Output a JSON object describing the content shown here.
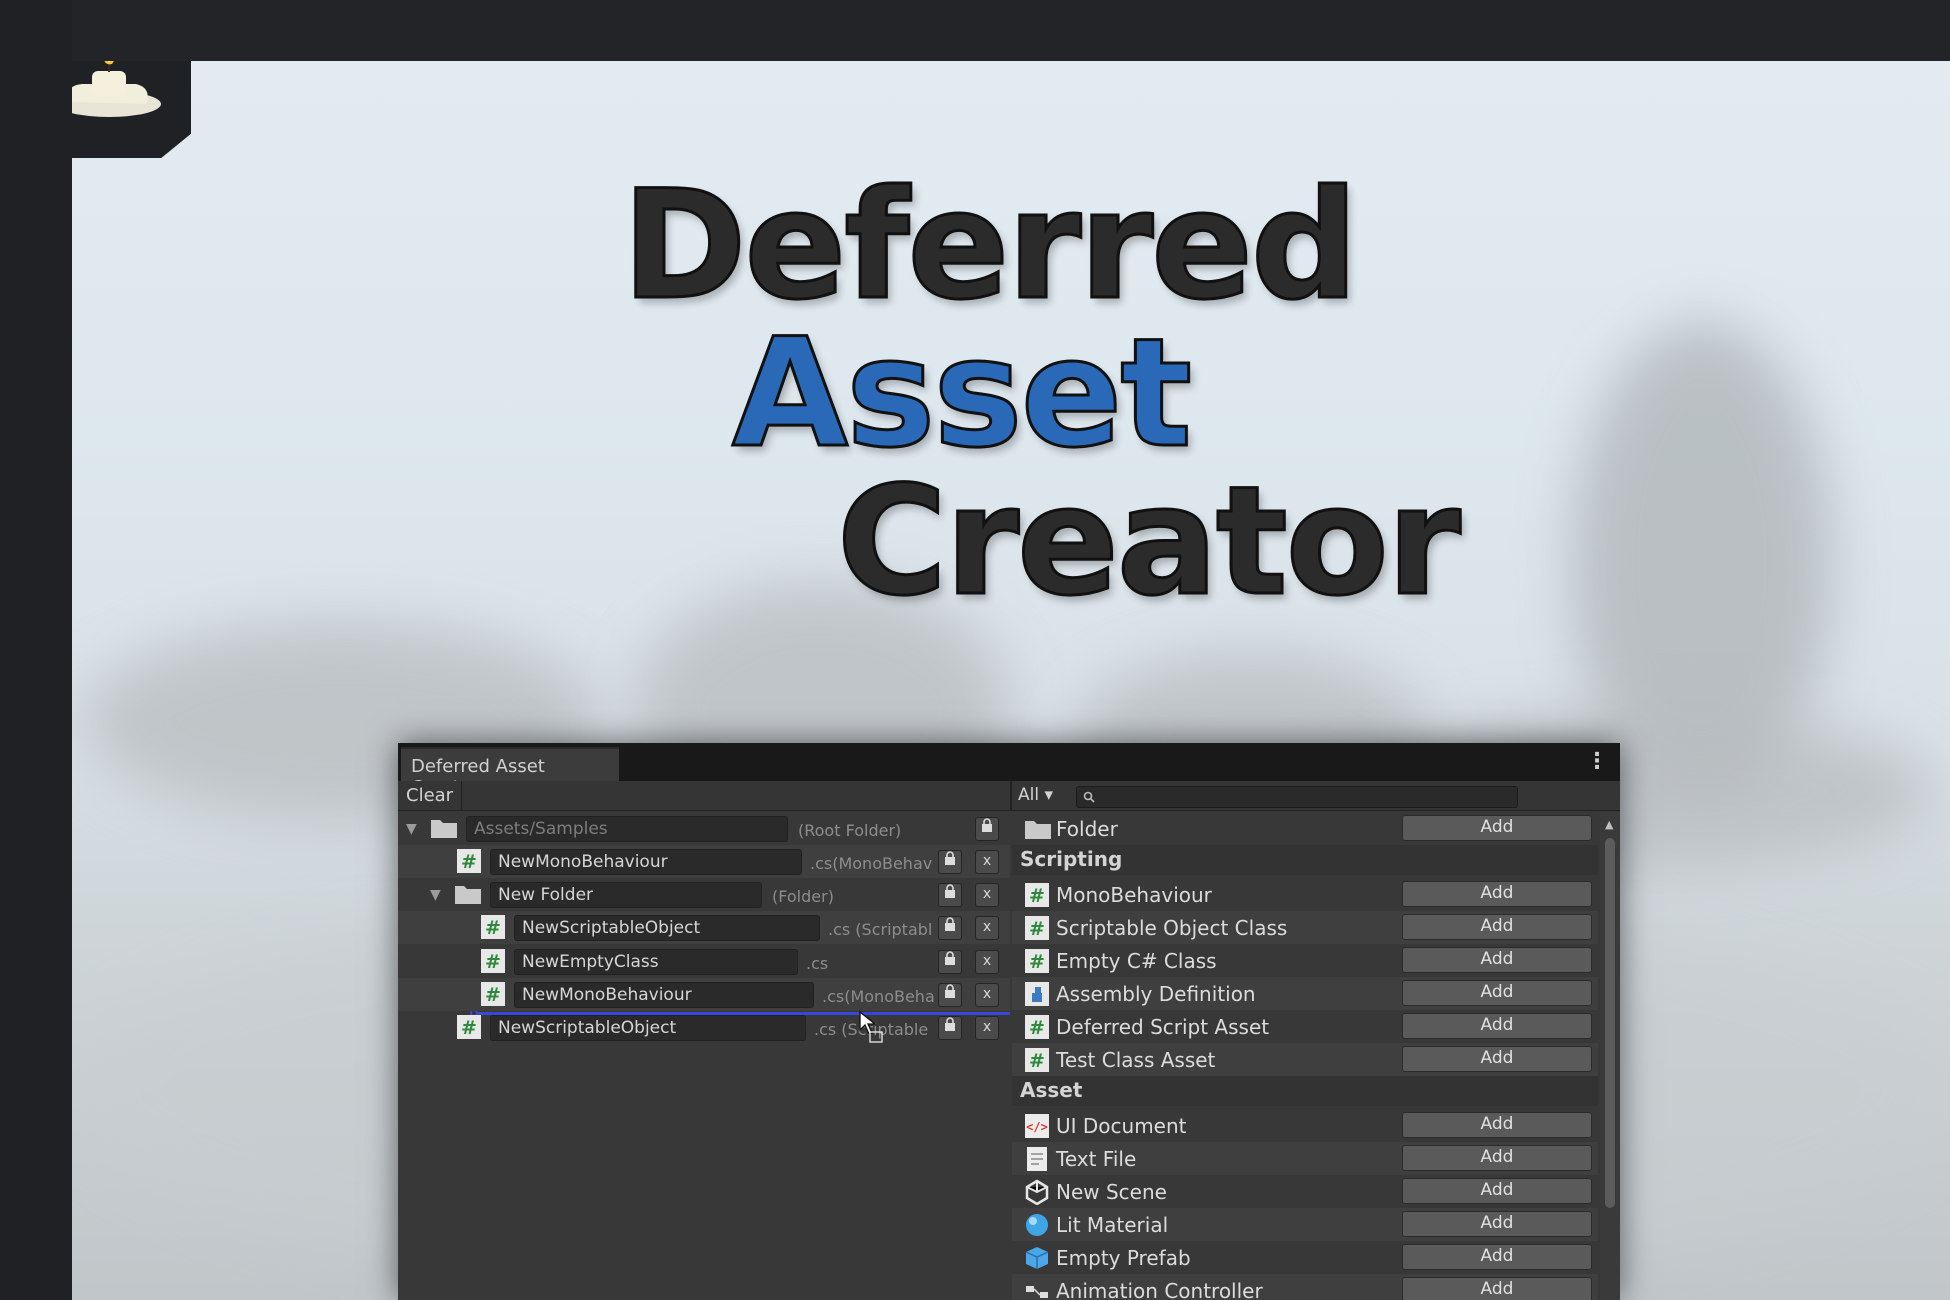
{
  "banner": {
    "line1": "Deferred",
    "line2": "Asset",
    "line3": "Creator",
    "colors": {
      "dark": "#2b2b2b",
      "accent": "#2a69b8"
    }
  },
  "window": {
    "tab_title": "Deferred Asset Creator",
    "menu_glyph": "⋮",
    "toolbar": {
      "clear_label": "Clear",
      "filter_label": "All ▾",
      "search_placeholder": ""
    }
  },
  "tree": [
    {
      "name": "Assets/Samples",
      "ext": "(Root Folder)",
      "icon": "folder-icon",
      "muted": true,
      "close": ""
    },
    {
      "name": "NewMonoBehaviour",
      "ext": ".cs(MonoBehav",
      "icon": "csharp-script-icon",
      "close": "x"
    },
    {
      "name": "New Folder",
      "ext": "(Folder)",
      "icon": "folder-icon",
      "close": "x"
    },
    {
      "name": "NewScriptableObject",
      "ext": ".cs (Scriptabl",
      "icon": "csharp-script-icon",
      "close": "x"
    },
    {
      "name": "NewEmptyClass",
      "ext": ".cs",
      "icon": "csharp-script-icon",
      "close": "x"
    },
    {
      "name": "NewMonoBehaviour",
      "ext": ".cs(MonoBeha",
      "icon": "csharp-script-icon",
      "close": "x"
    },
    {
      "name": "NewScriptableObject",
      "ext": ".cs (Scriptable",
      "icon": "csharp-script-icon",
      "close": "x"
    }
  ],
  "catalog": {
    "add_label": "Add",
    "folder_item": {
      "label": "Folder",
      "icon": "folder-icon"
    },
    "sections": [
      {
        "title": "Scripting",
        "items": [
          {
            "label": "MonoBehaviour",
            "icon": "csharp-script-icon"
          },
          {
            "label": "Scriptable Object Class",
            "icon": "csharp-script-icon"
          },
          {
            "label": "Empty C# Class",
            "icon": "csharp-script-icon"
          },
          {
            "label": "Assembly Definition",
            "icon": "assembly-definition-icon"
          },
          {
            "label": "Deferred Script Asset",
            "icon": "csharp-script-icon"
          },
          {
            "label": "Test Class Asset",
            "icon": "csharp-script-icon"
          }
        ]
      },
      {
        "title": "Asset",
        "items": [
          {
            "label": "UI Document",
            "icon": "ui-document-icon"
          },
          {
            "label": "Text File",
            "icon": "text-file-icon"
          },
          {
            "label": "New Scene",
            "icon": "unity-scene-icon"
          },
          {
            "label": "Lit Material",
            "icon": "material-sphere-icon"
          },
          {
            "label": "Empty Prefab",
            "icon": "prefab-cube-icon"
          },
          {
            "label": "Animation Controller",
            "icon": "animator-icon"
          }
        ]
      }
    ]
  }
}
